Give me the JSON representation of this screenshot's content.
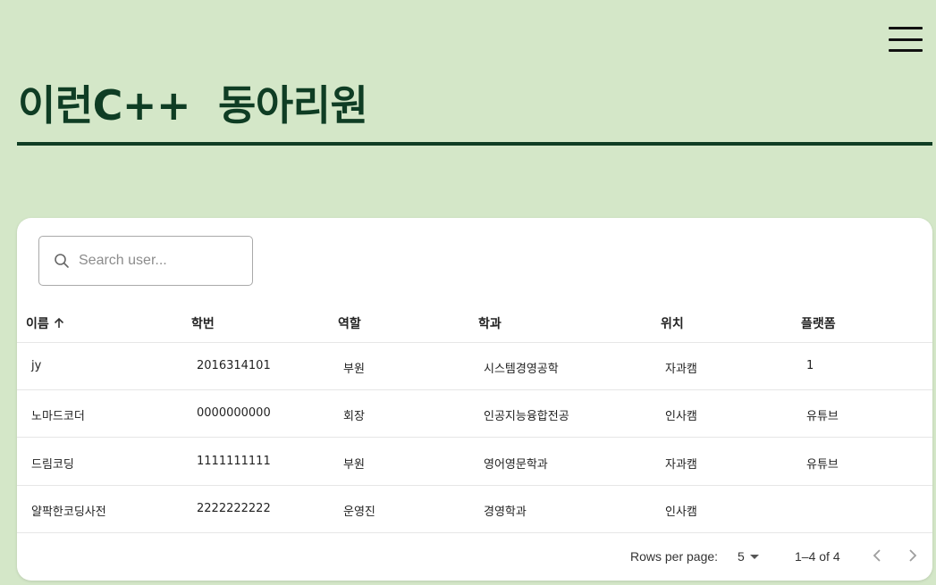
{
  "header": {
    "title": "이런C++  동아리원"
  },
  "search": {
    "placeholder": "Search user..."
  },
  "table": {
    "columns": [
      "이름",
      "학번",
      "역할",
      "학과",
      "위치",
      "플랫폼"
    ],
    "rows": [
      [
        "jy",
        "2016314101",
        "부원",
        "시스템경영공학",
        "자과캠",
        "1"
      ],
      [
        "노마드코더",
        "0000000000",
        "회장",
        "인공지능융합전공",
        "인사캠",
        "유튜브"
      ],
      [
        "드림코딩",
        "1111111111",
        "부원",
        "영어영문학과",
        "자과캠",
        "유튜브"
      ],
      [
        "얄팍한코딩사전",
        "2222222222",
        "운영진",
        "경영학과",
        "인사캠",
        ""
      ]
    ]
  },
  "pagination": {
    "rows_per_page_label": "Rows per page:",
    "rows_per_page_value": "5",
    "range_text": "1–4 of 4"
  },
  "icons": {
    "menu": "hamburger-menu-icon",
    "search": "search-icon",
    "sort": "arrow-up-icon",
    "select": "caret-down-icon",
    "prev": "chevron-left-icon",
    "next": "chevron-right-icon"
  },
  "colors": {
    "background": "#d4e7c8",
    "title": "#0f3d24",
    "card": "#ffffff"
  }
}
